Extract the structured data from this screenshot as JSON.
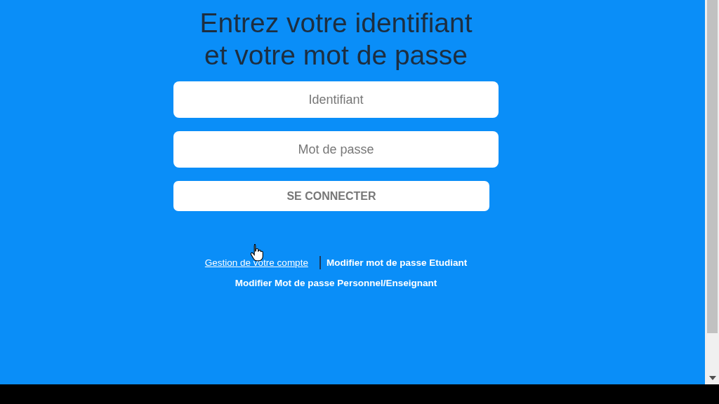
{
  "heading": [
    "Entrez votre identifiant",
    "et votre mot de passe"
  ],
  "fields": [
    {
      "placeholder": "Identifiant"
    },
    {
      "placeholder": "Mot de passe"
    }
  ],
  "button": {
    "label": "SE CONNECTER"
  },
  "links": [
    {
      "label": "Gestion de votre compte",
      "hovered": true
    },
    {
      "label": "Modifier mot de passe Etudiant",
      "hovered": false
    },
    {
      "label": "Modifier Mot de passe Personnel/Enseignant",
      "hovered": false
    }
  ]
}
